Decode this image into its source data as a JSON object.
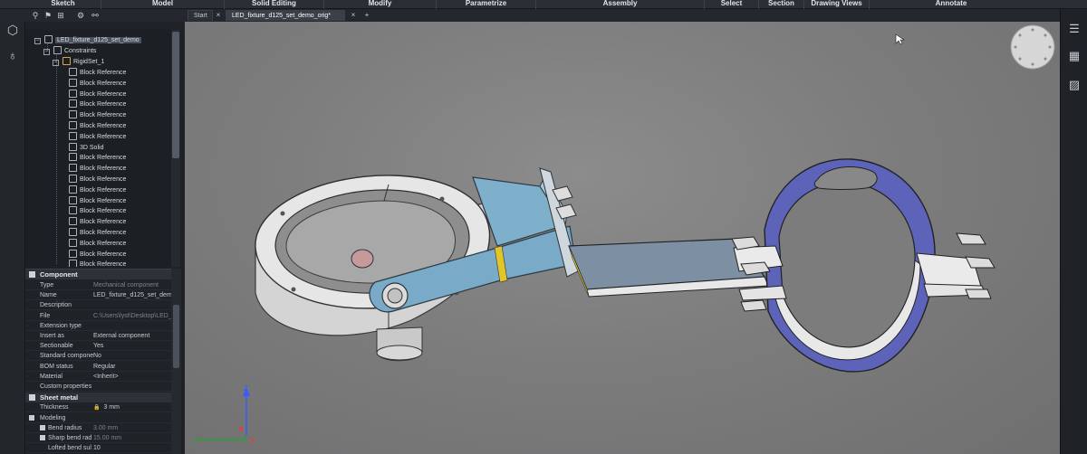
{
  "ribbon": {
    "tabs": [
      "Sketch",
      "Model",
      "Solid Editing",
      "Modify",
      "Parametrize",
      "Assembly",
      "Select",
      "Section",
      "Drawing Views",
      "Annotate"
    ]
  },
  "tabs": {
    "start": "Start",
    "document": "LED_fixture_d125_set_demo_orig*",
    "close_glyph": "×",
    "new_glyph": "+"
  },
  "tree": {
    "root": "LED_fixture_d125_set_demo",
    "constraints": "Constraints",
    "rigidset": "RigidSet_1",
    "items": [
      "Block Reference",
      "Block Reference",
      "Block Reference",
      "Block Reference",
      "Block Reference",
      "Block Reference",
      "Block Reference",
      "3D Solid",
      "Block Reference",
      "Block Reference",
      "Block Reference",
      "Block Reference",
      "Block Reference",
      "Block Reference",
      "Block Reference",
      "Block Reference",
      "Block Reference",
      "Block Reference",
      "Block Reference"
    ]
  },
  "properties": {
    "component_header": "Component",
    "rows": [
      {
        "key": "Type",
        "value": "Mechanical component",
        "dim": true
      },
      {
        "key": "Name",
        "value": "LED_fixture_d125_set_demo",
        "dim": false
      },
      {
        "key": "Description",
        "value": "",
        "dim": false
      },
      {
        "key": "File",
        "value": "C:\\Users\\lyst\\Desktop\\LED_",
        "dim": true
      },
      {
        "key": "Extension type",
        "value": "",
        "dim": false
      },
      {
        "key": "Insert as",
        "value": "External component",
        "dim": false
      },
      {
        "key": "Sectionable",
        "value": "Yes",
        "dim": false
      },
      {
        "key": "Standard compone",
        "value": "No",
        "dim": false
      },
      {
        "key": "BOM status",
        "value": "Regular",
        "dim": false
      },
      {
        "key": "Material",
        "value": "<Inherit>",
        "dim": false
      },
      {
        "key": "Custom properties",
        "value": "",
        "dim": false
      }
    ],
    "sheetmetal_header": "Sheet metal",
    "thickness_key": "Thickness",
    "thickness_value": "3 mm",
    "modeling_key": "Modeling",
    "bend_radius_key": "Bend radius",
    "bend_radius_value": "3.00 mm",
    "sharp_bend_key": "Sharp bend rad",
    "sharp_bend_value": "15.00 mm",
    "lofted_key": "Lofted bend sul",
    "lofted_value": "10"
  },
  "axes": {
    "z": "Z",
    "x": "X"
  },
  "colors": {
    "viewport_bg": "#7d7d7e",
    "clamp_blue": "#5b63b8",
    "bracket_blue": "#7fb0cc",
    "housing_gray": "#d8d8d8",
    "accent_yellow": "#e2c52a"
  }
}
